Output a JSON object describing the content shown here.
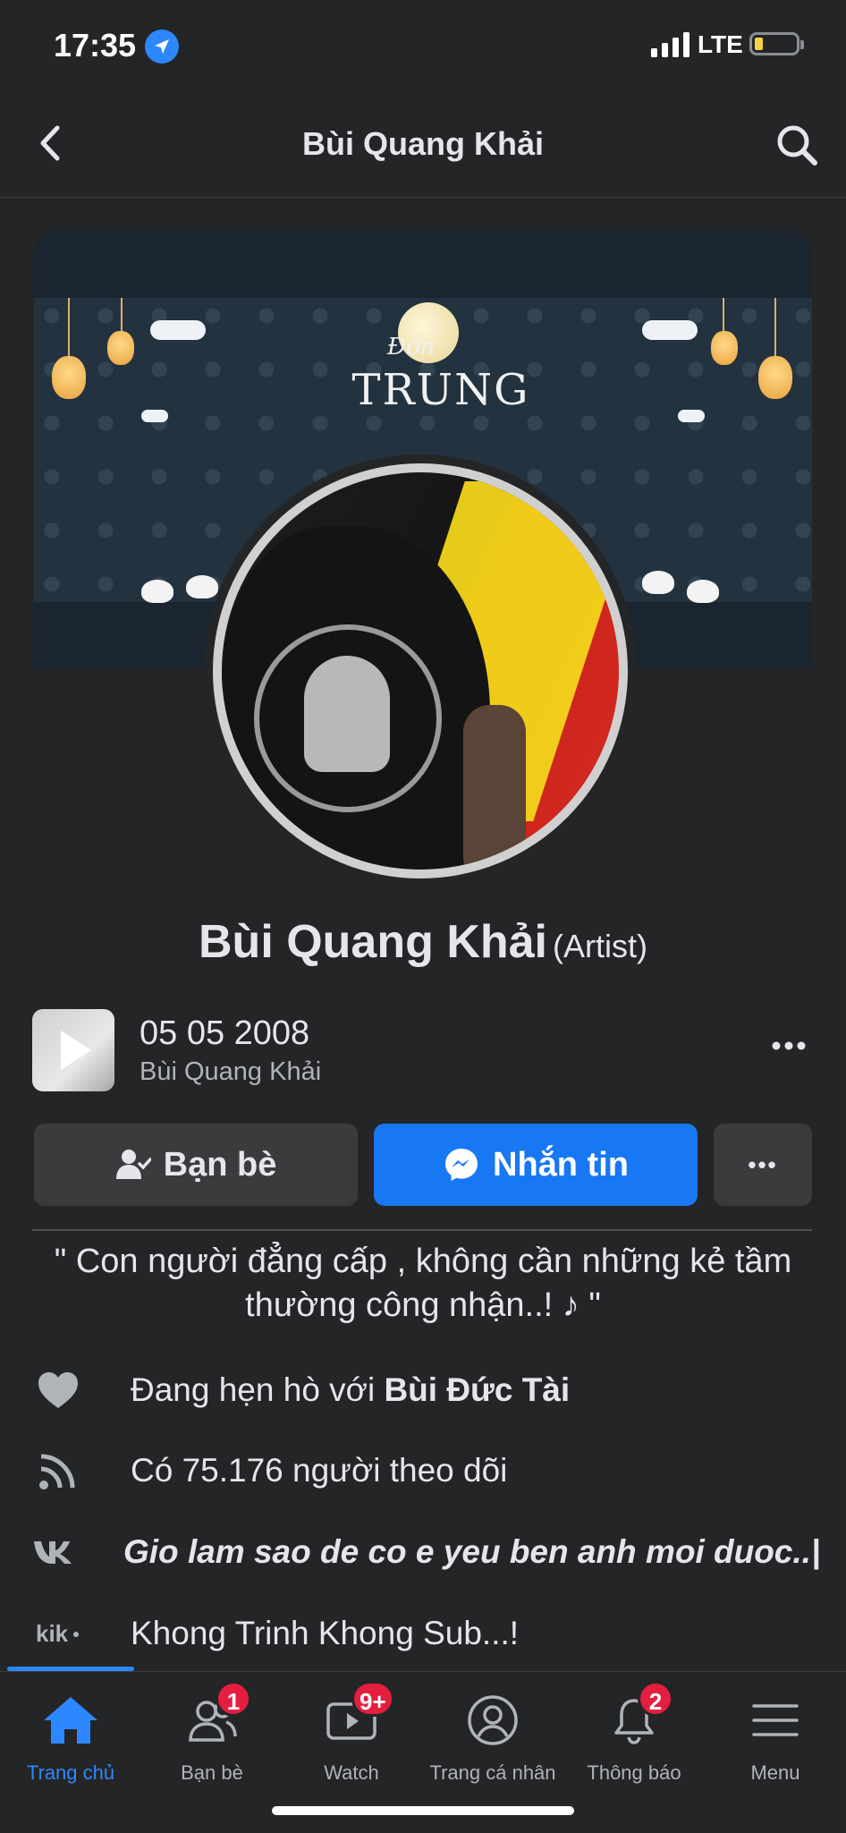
{
  "status_bar": {
    "time": "17:35",
    "network": "LTE"
  },
  "header": {
    "title": "Bùi Quang Khải"
  },
  "cover": {
    "title": "TRUNG",
    "subtitle": "Đón"
  },
  "profile": {
    "name": "Bùi Quang Khải",
    "role": "(Artist)"
  },
  "story": {
    "date": "05 05 2008",
    "name": "Bùi Quang Khải"
  },
  "actions": {
    "friends_label": "Bạn bè",
    "message_label": "Nhắn tin",
    "more_label": "•••"
  },
  "bio": "\" Con người đẳng cấp , không cần những kẻ tầm thường công nhận..! ♪ \"",
  "info": {
    "relationship_prefix": "Đang hẹn hò với ",
    "relationship_partner": "Bùi Đức Tài",
    "followers": "Có 75.176 người theo dõi",
    "vk": "Gio lam sao de co e yeu ben anh moi duoc..|",
    "kik": "Khong Trinh Khong Sub...!"
  },
  "bottom_nav": [
    {
      "label": "Trang chủ",
      "badge": ""
    },
    {
      "label": "Bạn bè",
      "badge": "1"
    },
    {
      "label": "Watch",
      "badge": "9+"
    },
    {
      "label": "Trang cá nhân",
      "badge": ""
    },
    {
      "label": "Thông báo",
      "badge": "2"
    },
    {
      "label": "Menu",
      "badge": ""
    }
  ],
  "colors": {
    "accent": "#1877f2",
    "background": "#242526",
    "badge": "#e41e3f"
  }
}
